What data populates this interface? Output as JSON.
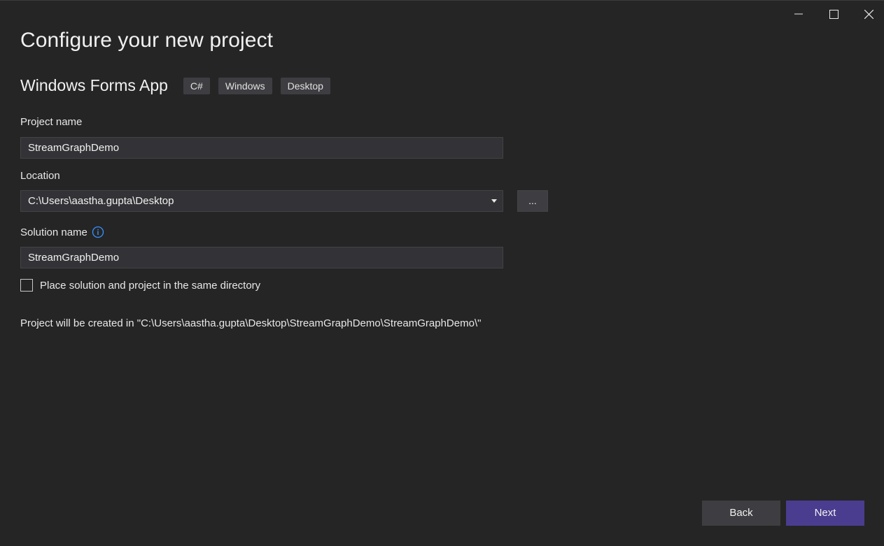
{
  "window": {
    "controls": {
      "minimize_icon": "minimize-icon",
      "maximize_icon": "maximize-icon",
      "close_icon": "close-icon"
    }
  },
  "header": {
    "title": "Configure your new project"
  },
  "template": {
    "name": "Windows Forms App",
    "tags": [
      "C#",
      "Windows",
      "Desktop"
    ]
  },
  "form": {
    "project_name_label": "Project name",
    "project_name_value": "StreamGraphDemo",
    "location_label": "Location",
    "location_value": "C:\\Users\\aastha.gupta\\Desktop",
    "browse_label": "...",
    "solution_name_label": "Solution name",
    "solution_name_value": "StreamGraphDemo",
    "same_directory_label": "Place solution and project in the same directory",
    "same_directory_checked": false,
    "created_path_text": "Project will be created in \"C:\\Users\\aastha.gupta\\Desktop\\StreamGraphDemo\\StreamGraphDemo\\\""
  },
  "footer": {
    "back_label": "Back",
    "next_label": "Next"
  },
  "colors": {
    "background": "#252526",
    "accent": "#4a3d8f",
    "info_icon": "#3794ff"
  }
}
